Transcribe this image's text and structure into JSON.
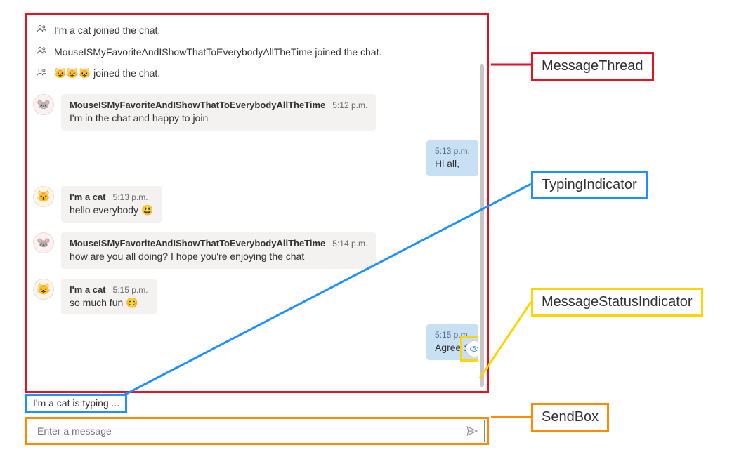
{
  "system_events": [
    {
      "text": "I'm a cat joined the chat."
    },
    {
      "text": "MouseISMyFavoriteAndIShowThatToEverybodyAllTheTime joined the chat."
    },
    {
      "text": "😺😺😺 joined the chat."
    }
  ],
  "messages": [
    {
      "author": "MouseISMyFavoriteAndIShowThatToEverybodyAllTheTime",
      "avatar": "mouse",
      "avatarGlyph": "🐭",
      "time": "5:12 p.m.",
      "body": "I'm in the chat and happy to join",
      "mine": false
    },
    {
      "time": "5:13 p.m.",
      "body": "Hi all,",
      "mine": true
    },
    {
      "author": "I'm a cat",
      "avatar": "cat",
      "avatarGlyph": "😺",
      "time": "5:13 p.m.",
      "body": "hello everybody 😃",
      "mine": false
    },
    {
      "author": "MouseISMyFavoriteAndIShowThatToEverybodyAllTheTime",
      "avatar": "mouse",
      "avatarGlyph": "🐭",
      "time": "5:14 p.m.",
      "body": "how are you all doing? I hope you're enjoying the chat",
      "mine": false
    },
    {
      "author": "I'm a cat",
      "avatar": "cat",
      "avatarGlyph": "😺",
      "time": "5:15 p.m.",
      "body": "so much fun 😊",
      "mine": false
    },
    {
      "time": "5:15 p.m.",
      "body": "Agree :)",
      "mine": true,
      "status": "seen"
    }
  ],
  "typing_indicator": "I'm a cat is typing ...",
  "sendbox": {
    "placeholder": "Enter a message"
  },
  "callouts": {
    "message_thread": "MessageThread",
    "typing_indicator": "TypingIndicator",
    "message_status": "MessageStatusIndicator",
    "send_box": "SendBox"
  }
}
